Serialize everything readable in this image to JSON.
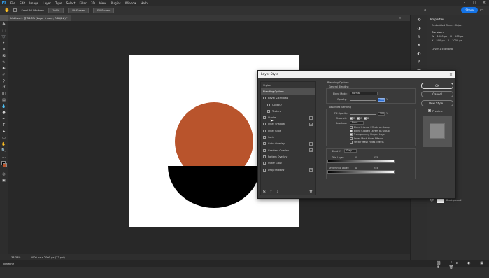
{
  "menu": [
    "File",
    "Edit",
    "Image",
    "Layer",
    "Type",
    "Select",
    "Filter",
    "3D",
    "View",
    "Plugins",
    "Window",
    "Help"
  ],
  "app_logo": "Ps",
  "options_bar": {
    "scroll_all": "Scroll All Windows",
    "zoom": "100%",
    "fit_screen": "Fit Screen",
    "fill_screen": "Fill Screen"
  },
  "share_label": "Share",
  "document_tab": "Untitled-1 @ 33.3% (Layer 1 copy, RGB/8#) *",
  "status": {
    "zoom": "33.33%",
    "doc_size": "2000 px x 2000 px (72 ppi)"
  },
  "timeline_label": "Timeline",
  "properties": {
    "title": "Properties",
    "subtitle": "Embedded Smart Object",
    "transform": "Transform",
    "w": "W",
    "w_val": "1000 px",
    "h": "H",
    "h_val": "500 px",
    "x": "X",
    "x_val": "500 px",
    "y": "Y",
    "y_val": "1000 px",
    "layer_name": "Layer 1 copy.psb"
  },
  "layers": {
    "background": "Background"
  },
  "dialog": {
    "title": "Layer Style",
    "styles_header": "Styles",
    "blending_options": "Blending Options",
    "style_items": [
      {
        "label": "Bevel & Emboss",
        "plus": false,
        "indent": false
      },
      {
        "label": "Contour",
        "plus": false,
        "indent": true
      },
      {
        "label": "Texture",
        "plus": false,
        "indent": true
      },
      {
        "label": "Stroke",
        "plus": true,
        "indent": false
      },
      {
        "label": "Inner Shadow",
        "plus": true,
        "indent": false
      },
      {
        "label": "Inner Glow",
        "plus": false,
        "indent": false
      },
      {
        "label": "Satin",
        "plus": false,
        "indent": false
      },
      {
        "label": "Color Overlay",
        "plus": true,
        "indent": false
      },
      {
        "label": "Gradient Overlay",
        "plus": true,
        "indent": false
      },
      {
        "label": "Pattern Overlay",
        "plus": false,
        "indent": false
      },
      {
        "label": "Outer Glow",
        "plus": false,
        "indent": false
      },
      {
        "label": "Drop Shadow",
        "plus": true,
        "indent": false
      }
    ],
    "fx": "fx",
    "section_title": "Blending Options",
    "general": "General Blending",
    "blend_mode_label": "Blend Mode:",
    "blend_mode_value": "Normal",
    "opacity_label": "Opacity:",
    "opacity_value": "100",
    "pct": "%",
    "advanced": "Advanced Blending",
    "fill_opacity_label": "Fill Opacity:",
    "fill_opacity_value": "100",
    "channels_label": "Channels:",
    "ch_r": "R",
    "ch_g": "G",
    "ch_b": "B",
    "knockout_label": "Knockout:",
    "knockout_value": "None",
    "checks": [
      {
        "label": "Blend Interior Effects as Group",
        "on": false
      },
      {
        "label": "Blend Clipped Layers as Group",
        "on": true
      },
      {
        "label": "Transparency Shapes Layer",
        "on": true
      },
      {
        "label": "Layer Mask Hides Effects",
        "on": false
      },
      {
        "label": "Vector Mask Hides Effects",
        "on": false
      }
    ],
    "blend_if_label": "Blend If:",
    "blend_if_value": "Gray",
    "this_layer_label": "This Layer:",
    "this_layer_min": "0",
    "this_layer_max": "255",
    "underlying_label": "Underlying Layer:",
    "underlying_min": "0",
    "underlying_max": "255",
    "ok": "OK",
    "cancel": "Cancel",
    "new_style": "New Style...",
    "preview": "Preview"
  },
  "colors": {
    "circle": "#b9542c",
    "bowl": "#000000",
    "accent": "#1473e6"
  }
}
